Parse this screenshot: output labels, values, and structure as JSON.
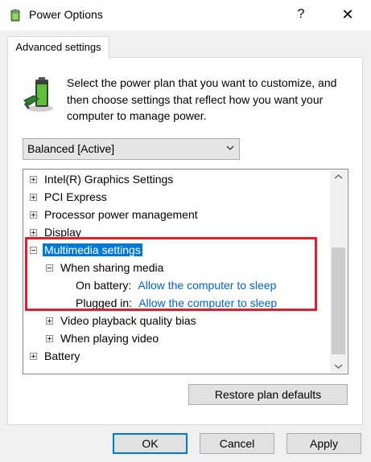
{
  "window": {
    "title": "Power Options",
    "help_label": "?",
    "close_label": "✕"
  },
  "tab": {
    "label": "Advanced settings"
  },
  "description": "Select the power plan that you want to customize, and then choose settings that reflect how you want your computer to manage power.",
  "plan_select": {
    "value": "Balanced [Active]"
  },
  "tree": {
    "items": [
      {
        "label": "Intel(R) Graphics Settings",
        "expander": "plus"
      },
      {
        "label": "PCI Express",
        "expander": "plus"
      },
      {
        "label": "Processor power management",
        "expander": "plus"
      },
      {
        "label": "Display",
        "expander": "plus"
      },
      {
        "label": "Multimedia settings",
        "expander": "minus",
        "selected": true
      },
      {
        "label": "When sharing media",
        "expander": "minus"
      },
      {
        "label": "On battery:",
        "value": "Allow the computer to sleep"
      },
      {
        "label": "Plugged in:",
        "value": "Allow the computer to sleep"
      },
      {
        "label": "Video playback quality bias",
        "expander": "plus"
      },
      {
        "label": "When playing video",
        "expander": "plus"
      },
      {
        "label": "Battery",
        "expander": "plus"
      }
    ]
  },
  "buttons": {
    "restore": "Restore plan defaults",
    "ok": "OK",
    "cancel": "Cancel",
    "apply": "Apply"
  },
  "colors": {
    "selection": "#0078d7",
    "link": "#0066cc",
    "highlight_border": "#e0202e"
  }
}
